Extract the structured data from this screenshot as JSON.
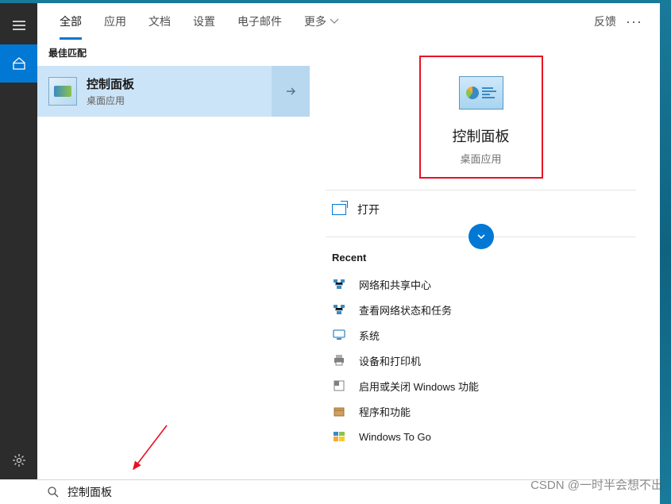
{
  "tabs": {
    "items": [
      "全部",
      "应用",
      "文档",
      "设置",
      "电子邮件",
      "更多"
    ],
    "active_index": 0,
    "feedback": "反馈"
  },
  "left": {
    "best_match_label": "最佳匹配",
    "result": {
      "title": "控制面板",
      "subtitle": "桌面应用"
    }
  },
  "right": {
    "hero_title": "控制面板",
    "hero_subtitle": "桌面应用",
    "open_label": "打开",
    "recent_title": "Recent",
    "recent_items": [
      "网络和共享中心",
      "查看网络状态和任务",
      "系统",
      "设备和打印机",
      "启用或关闭 Windows 功能",
      "程序和功能",
      "Windows To Go"
    ]
  },
  "search": {
    "value": "控制面板"
  },
  "watermark": "CSDN @一时半会想不出"
}
